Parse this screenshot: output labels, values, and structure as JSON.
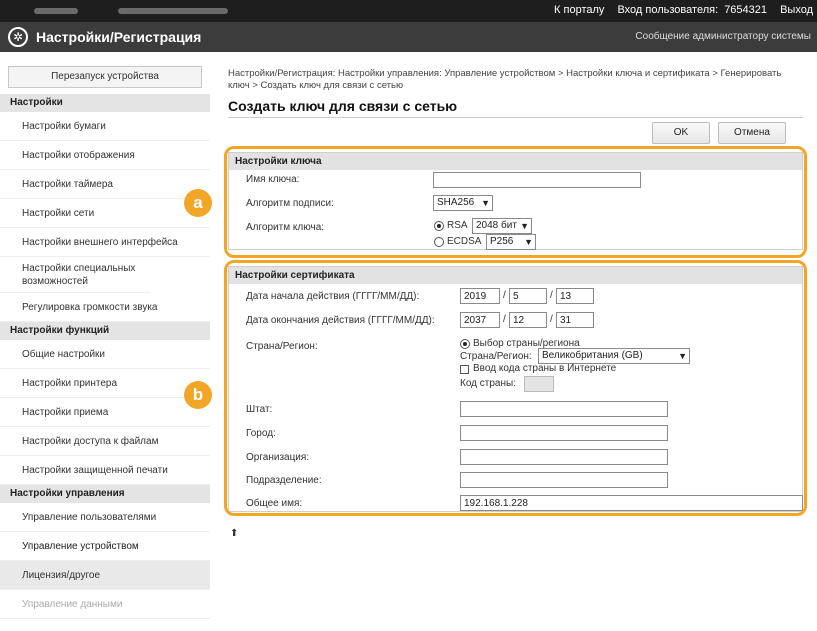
{
  "topbar": {
    "portal": "К порталу",
    "login_label": "Вход пользователя:",
    "user": "7654321",
    "logout": "Выход"
  },
  "titlebar": {
    "title": "Настройки/Регистрация",
    "admin_message": "Сообщение администратору системы"
  },
  "sidebar": {
    "restart": "Перезапуск устройства",
    "sections": [
      {
        "heading": "Настройки",
        "items": [
          "Настройки бумаги",
          "Настройки отображения",
          "Настройки таймера",
          "Настройки сети",
          "Настройки внешнего интерфейса",
          "Настройки специальных возможностей",
          "Регулировка громкости звука"
        ]
      },
      {
        "heading": "Настройки функций",
        "items": [
          "Общие настройки",
          "Настройки принтера",
          "Настройки приема",
          "Настройки доступа к файлам",
          "Настройки защищенной печати"
        ]
      },
      {
        "heading": "Настройки управления",
        "items": [
          "Управление пользователями",
          "Управление устройством",
          "Лицензия/другое",
          "Управление данными"
        ]
      }
    ]
  },
  "breadcrumb": "Настройки/Регистрация: Настройки управления: Управление устройством > Настройки ключа и сертификата > Генерировать ключ > Создать ключ для связи с сетью",
  "page_title": "Создать ключ для связи с сетью",
  "buttons": {
    "ok": "OK",
    "cancel": "Отмена"
  },
  "key_settings": {
    "heading": "Настройки ключа",
    "key_name_label": "Имя ключа:",
    "key_name_value": "",
    "signature_label": "Алгоритм подписи:",
    "signature_value": "SHA256",
    "algorithm_label": "Алгоритм ключа:",
    "rsa_label": "RSA",
    "rsa_value": "2048 бит",
    "ecdsa_label": "ECDSA",
    "ecdsa_value": "P256"
  },
  "cert_settings": {
    "heading": "Настройки сертификата",
    "start_label": "Дата начала действия (ГГГГ/ММ/ДД):",
    "start": {
      "y": "2019",
      "m": "5",
      "d": "13"
    },
    "end_label": "Дата окончания действия (ГГГГ/ММ/ДД):",
    "end": {
      "y": "2037",
      "m": "12",
      "d": "31"
    },
    "sep": "/",
    "country_label": "Страна/Регион:",
    "select_region_label": "Выбор страны/региона",
    "country_inner_label": "Страна/Регион:",
    "country_value": "Великобритания (GB)",
    "internet_code_label": "Ввод кода страны в Интернете",
    "country_code_label": "Код страны:",
    "state_label": "Штат:",
    "city_label": "Город:",
    "org_label": "Организация:",
    "dept_label": "Подразделение:",
    "common_label": "Общее имя:",
    "common_value": "192.168.1.228"
  },
  "callouts": {
    "a": "a",
    "b": "b"
  },
  "top_marker": "⬆"
}
